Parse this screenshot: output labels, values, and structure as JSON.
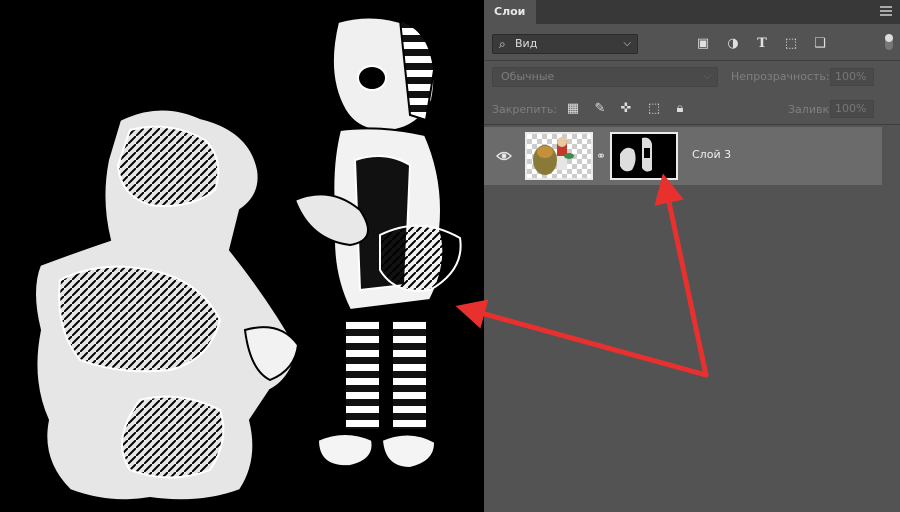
{
  "panel": {
    "tab_label": "Слои",
    "filter": {
      "icon": "search-icon",
      "value": "Вид"
    },
    "filter_icons": [
      "image-filter-icon",
      "adjustment-filter-icon",
      "type-filter-icon",
      "shape-filter-icon",
      "smart-object-filter-icon"
    ],
    "blend_mode": "Обычные",
    "opacity_label": "Непрозрачность:",
    "opacity_value": "100%",
    "lock_label": "Закрепить:",
    "lock_icons": [
      "lock-transparent-icon",
      "lock-image-icon",
      "lock-position-icon",
      "lock-artboard-icon",
      "lock-all-icon"
    ],
    "fill_label": "Заливка:",
    "fill_value": "100%"
  },
  "layers": [
    {
      "name": "Слой 3",
      "visible": true,
      "has_mask": true,
      "linked": true
    }
  ],
  "colors": {
    "panel_bg": "#535353",
    "selected_layer": "#6b6b6b",
    "annotation_arrow": "#e8302e",
    "canvas_bg": "#000000"
  }
}
